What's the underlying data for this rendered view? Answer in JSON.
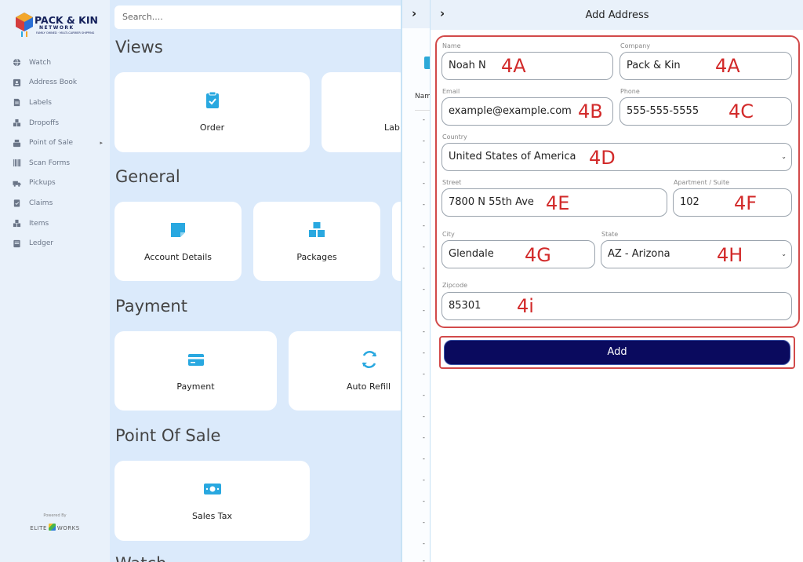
{
  "sidebar": {
    "logo_name": "PACK & KIN",
    "logo_sub": "NETWORK",
    "logo_tag": "FAMILY OWNED · MULTI-CARRIER SHIPPING",
    "items": [
      {
        "label": "Watch",
        "icon": "globe-icon"
      },
      {
        "label": "Address Book",
        "icon": "contact-card-icon"
      },
      {
        "label": "Labels",
        "icon": "document-icon"
      },
      {
        "label": "Dropoffs",
        "icon": "boxes-icon"
      },
      {
        "label": "Point of Sale",
        "icon": "register-icon",
        "caret": "▸"
      },
      {
        "label": "Scan Forms",
        "icon": "barcode-icon"
      },
      {
        "label": "Pickups",
        "icon": "truck-icon"
      },
      {
        "label": "Claims",
        "icon": "clipboard-check-icon"
      },
      {
        "label": "Items",
        "icon": "boxes-icon"
      },
      {
        "label": "Ledger",
        "icon": "ledger-icon"
      }
    ],
    "powered_by": "Powered By",
    "elite_left": "ELITE",
    "elite_right": "WORKS"
  },
  "search": {
    "placeholder": "Search...."
  },
  "sections": {
    "views": "Views",
    "general": "General",
    "payment": "Payment",
    "pos": "Point Of Sale",
    "watch": "Watch"
  },
  "cards": {
    "order": "Order",
    "labels_partial": "Lab",
    "account_details": "Account Details",
    "packages": "Packages",
    "payment": "Payment",
    "auto_refill": "Auto Refill",
    "sales_tax": "Sales Tax"
  },
  "strip": {
    "col_header": "Nam",
    "dash": "-"
  },
  "panel": {
    "title": "Add Address",
    "fields": {
      "name": {
        "label": "Name",
        "value": "Noah N"
      },
      "company": {
        "label": "Company",
        "value": "Pack & Kin"
      },
      "email": {
        "label": "Email",
        "value": "example@example.com"
      },
      "phone": {
        "label": "Phone",
        "value": "555-555-5555"
      },
      "country": {
        "label": "Country",
        "value": "United States of America"
      },
      "street": {
        "label": "Street",
        "value": "7800 N 55th Ave"
      },
      "apt": {
        "label": "Apartment / Suite",
        "value": "102"
      },
      "city": {
        "label": "City",
        "value": "Glendale"
      },
      "state": {
        "label": "State",
        "value": "AZ - Arizona"
      },
      "zip": {
        "label": "Zipcode",
        "value": "85301"
      }
    },
    "add_label": "Add",
    "annotations": {
      "name": "4A",
      "company": "4A",
      "email": "4B",
      "phone": "4C",
      "country": "4D",
      "street": "4E",
      "apt": "4F",
      "city": "4G",
      "state": "4H",
      "zip": "4i"
    }
  },
  "colors": {
    "accent": "#29a8e0",
    "navy": "#0a0a5e",
    "annotation": "#d22a2a"
  }
}
